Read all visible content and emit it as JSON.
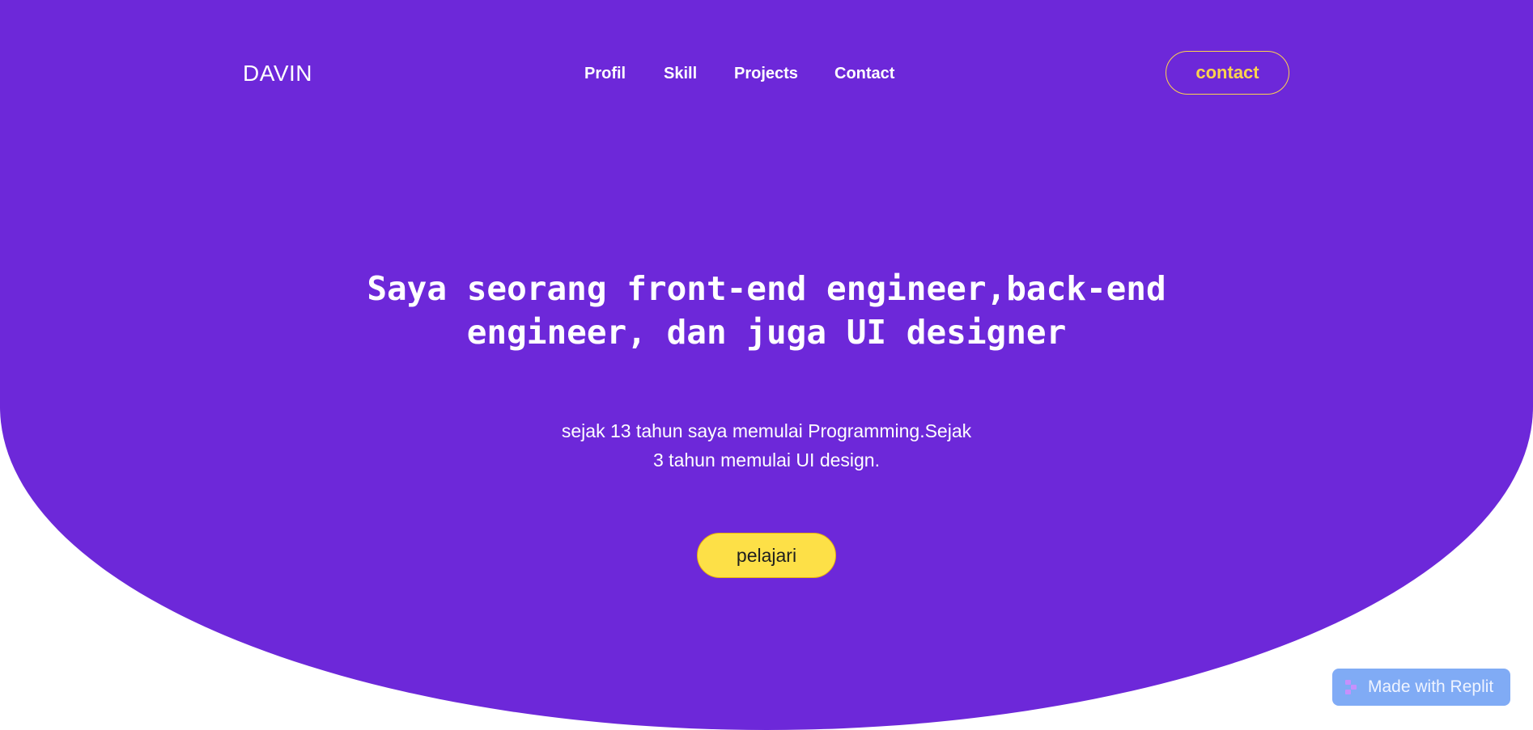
{
  "header": {
    "brand": "DAVIN",
    "nav": [
      {
        "label": "Profil"
      },
      {
        "label": "Skill"
      },
      {
        "label": "Projects"
      },
      {
        "label": "Contact"
      }
    ],
    "contact_button": "contact"
  },
  "hero": {
    "headline_line1": "Saya seorang front-end engineer,back-end",
    "headline_line2": "engineer, dan juga UI designer",
    "subtitle_line1": "sejak 13 tahun saya memulai Programming.Sejak",
    "subtitle_line2": "3 tahun memulai UI design.",
    "cta_label": "pelajari"
  },
  "badge": {
    "label": "Made with Replit",
    "icon": "replit-icon"
  },
  "colors": {
    "hero_bg": "#6d28d9",
    "accent_yellow": "#fde047",
    "contact_border": "#fcd34d",
    "badge_bg": "#73a2f5"
  }
}
